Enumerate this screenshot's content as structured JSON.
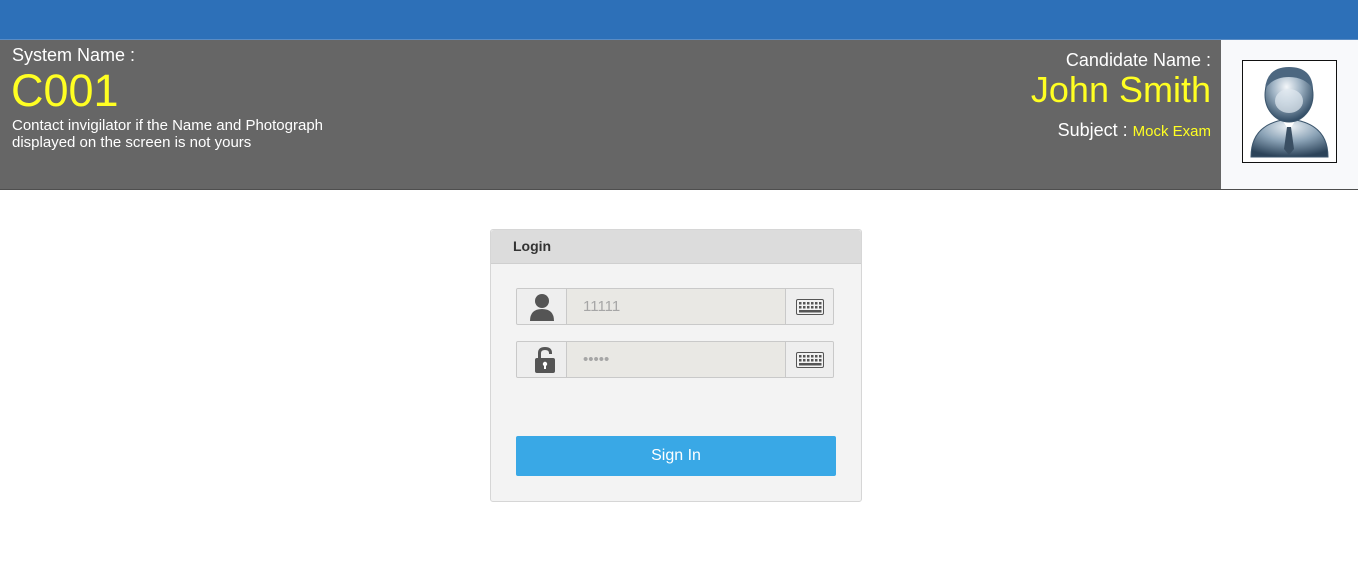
{
  "header": {
    "system_label": "System Name :",
    "system_name": "C001",
    "notice": "Contact invigilator if the Name and Photograph displayed on the screen is not yours",
    "candidate_label": "Candidate Name :",
    "candidate_name": "John Smith",
    "subject_label": "Subject :",
    "subject_value": "Mock Exam"
  },
  "login": {
    "title": "Login",
    "username_placeholder": "11111",
    "password_placeholder": "•••••",
    "signin_label": "Sign In"
  },
  "icons": {
    "username": "user-icon",
    "password": "lock-icon",
    "keyboard": "keyboard-icon",
    "photo": "candidate-avatar"
  },
  "colors": {
    "topbar": "#2d70b8",
    "header_bg": "#666666",
    "highlight": "#ffff22",
    "signin_button": "#39a8e6"
  }
}
